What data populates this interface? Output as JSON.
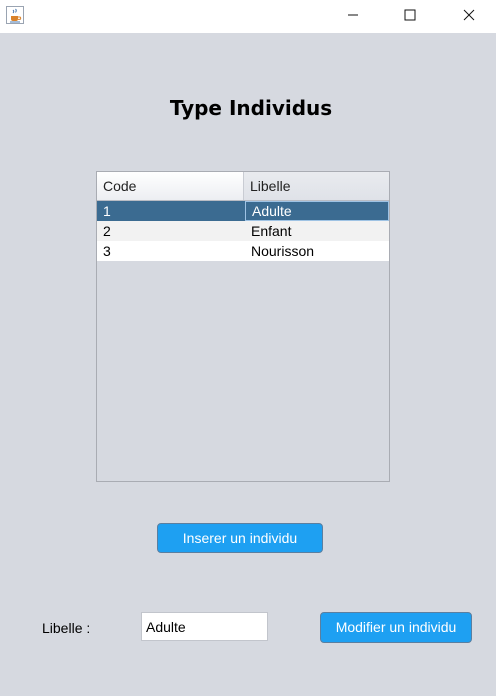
{
  "window": {
    "icon": "java-cup-icon",
    "controls": [
      "minimize",
      "maximize",
      "close"
    ]
  },
  "heading": "Type Individus",
  "table": {
    "columns": [
      "Code",
      "Libelle"
    ],
    "rows": [
      {
        "code": "1",
        "libelle": "Adulte"
      },
      {
        "code": "2",
        "libelle": "Enfant"
      },
      {
        "code": "3",
        "libelle": "Nourisson"
      }
    ],
    "selected_row": 0
  },
  "buttons": {
    "insert": "Inserer un individu",
    "modify": "Modifier un individu"
  },
  "form": {
    "libelle_label": "Libelle :",
    "libelle_value": "Adulte"
  },
  "colors": {
    "background": "#d6d9e0",
    "selection": "#3b6b91",
    "button": "#1ea0f2"
  }
}
